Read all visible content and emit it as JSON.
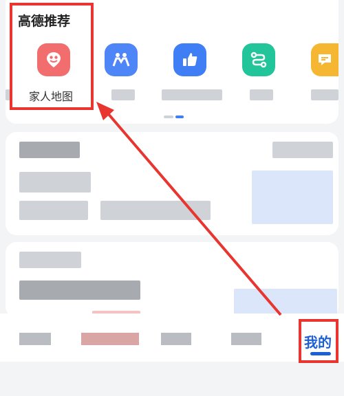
{
  "section": {
    "title": "高德推荐"
  },
  "apps": [
    {
      "label": "家人地图",
      "icon": "family-map-icon",
      "color": "#f26d6d"
    },
    {
      "label": "",
      "icon": "people-icon",
      "color": "#4f86f7"
    },
    {
      "label": "",
      "icon": "thumbs-up-icon",
      "color": "#3f7ef5"
    },
    {
      "label": "",
      "icon": "route-icon",
      "color": "#22c59a"
    },
    {
      "label": "",
      "icon": "message-icon",
      "color": "#f5b731"
    }
  ],
  "tabbar": {
    "mine_label": "我的"
  },
  "colors": {
    "annotation": "#e8352f",
    "accent": "#1d5fd6"
  }
}
